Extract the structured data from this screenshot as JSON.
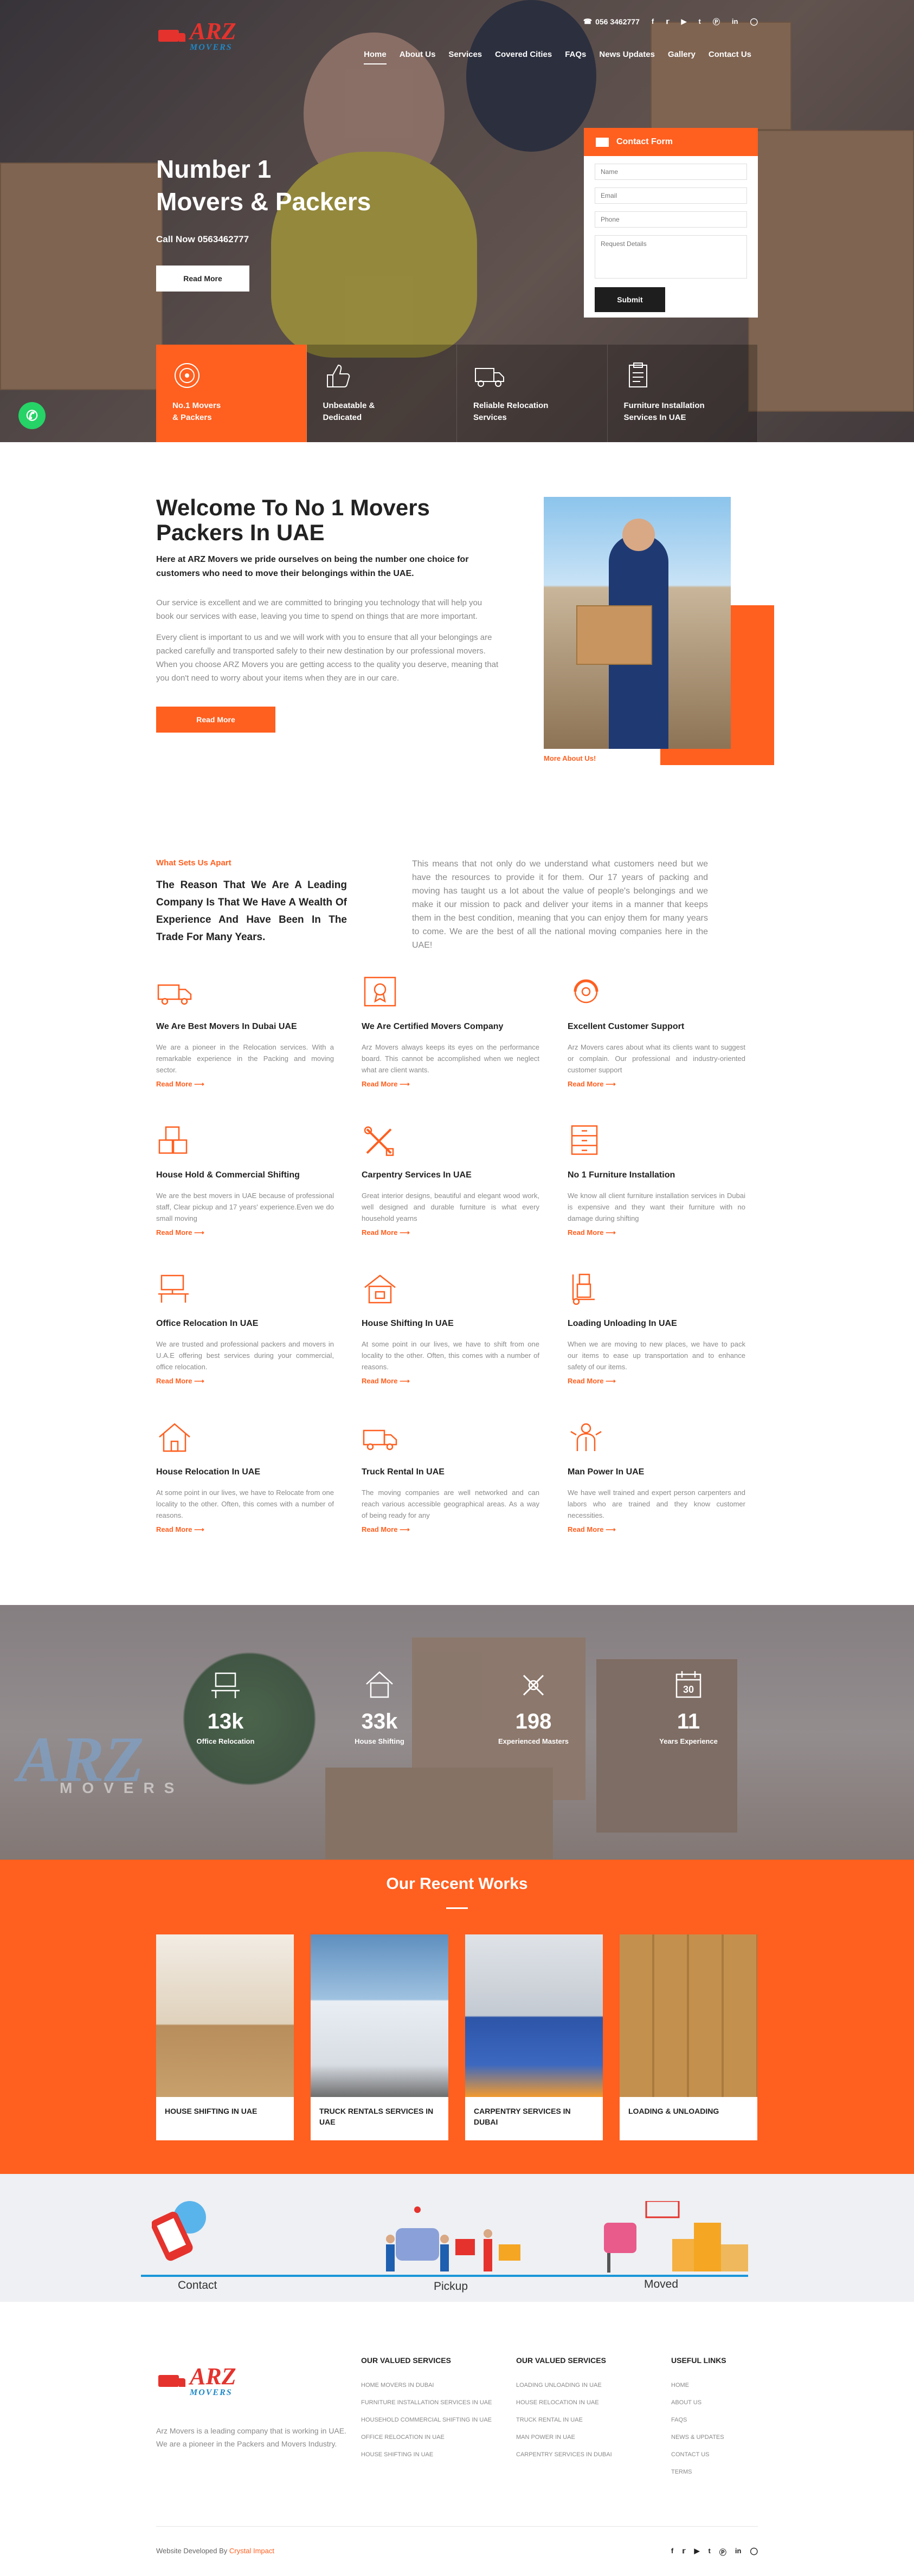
{
  "brand": {
    "logo_main": "ARZ",
    "logo_sub": "MOVERS",
    "accent": "#ff5f1f"
  },
  "topbar": {
    "phone": "056 3462777",
    "social": [
      "f",
      "t",
      "yt",
      "tu",
      "p",
      "in",
      "ig"
    ]
  },
  "nav": {
    "items": [
      "Home",
      "About Us",
      "Services",
      "Covered Cities",
      "FAQs",
      "News Updates",
      "Gallery",
      "Contact Us"
    ]
  },
  "hero": {
    "title_1": "Number 1",
    "title_2": "Movers & Packers",
    "call": "Call Now 0563462777",
    "button": "Read More"
  },
  "contact_form": {
    "title": "Contact Form",
    "name": "Name",
    "email": "Email",
    "phone": "Phone",
    "details": "Request Details",
    "submit": "Submit"
  },
  "features": [
    {
      "line1": "No.1 Movers",
      "line2": "& Packers",
      "icon": "target-icon"
    },
    {
      "line1": "Unbeatable &",
      "line2": "Dedicated",
      "icon": "thumbs-up-icon"
    },
    {
      "line1": "Reliable Relocation",
      "line2": "Services",
      "icon": "truck-icon"
    },
    {
      "line1": "Furniture Installation",
      "line2": "Services In UAE",
      "icon": "clipboard-icon"
    }
  ],
  "welcome": {
    "title": "Welcome To No 1 Movers Packers In UAE",
    "lead": "Here at ARZ Movers we pride ourselves on being the number one choice for customers who need to move their belongings within the UAE.",
    "p1": "Our service is excellent and we are committed to bringing you technology that will help you book our services with ease, leaving you time to spend on things that are more important.",
    "p2": "Every client is important to us and we will work with you to ensure that all your belongings are packed carefully and transported safely to their new destination by our professional movers. When you choose ARZ Movers you are getting access to the quality you deserve, meaning that you don't need to worry about your items when they are in our care.",
    "button": "Read More",
    "more_link": "More About Us!"
  },
  "sets_apart": {
    "tag": "What Sets Us Apart",
    "heading": "The Reason That We Are A Leading Company Is That We Have A Wealth Of Experience And Have Been In The Trade For Many Years.",
    "text": "This means that not only do we understand what customers need but we have the resources to provide it for them. Our 17 years of packing and moving has taught us a lot about the value of people's belongings and we make it our mission to pack and deliver your items in a manner that keeps them in the best condition, meaning that you can enjoy them for many years to come. We are the best of all the national moving companies here in the UAE!"
  },
  "services": [
    {
      "title": "We Are Best Movers In Dubai UAE",
      "text": "We are a pioneer in the Relocation services. With a remarkable experience in the Packing and moving sector.",
      "link": "Read More ⟶",
      "icon": "truck-icon"
    },
    {
      "title": "We Are Certified Movers Company",
      "text": "Arz Movers always keeps its eyes on the performance board. This cannot be accomplished when we neglect what are client wants.",
      "link": "Read More ⟶",
      "icon": "certificate-icon"
    },
    {
      "title": "Excellent Customer Support",
      "text": "Arz Movers cares about what its clients want to suggest or complain. Our professional and industry-oriented customer support",
      "link": "Read More ⟶",
      "icon": "support-icon"
    },
    {
      "title": "House Hold & Commercial Shifting",
      "text": "We are the best movers in UAE because of professional staff, Clear pickup and 17 years' experience.Even we do small moving",
      "link": "Read More ⟶",
      "icon": "boxes-icon"
    },
    {
      "title": "Carpentry Services In UAE",
      "text": "Great interior designs, beautiful and elegant wood work, well designed and durable furniture is what every household yearns",
      "link": "Read More ⟶",
      "icon": "tools-icon"
    },
    {
      "title": "No 1 Furniture Installation",
      "text": "We know all client furniture installation services in Dubai is expensive and they want their furniture with no damage during shifting",
      "link": "Read More ⟶",
      "icon": "cabinet-icon"
    },
    {
      "title": "Office Relocation In UAE",
      "text": "We are trusted and professional packers and movers in U.A.E offering best services during your commercial, office relocation.",
      "link": "Read More ⟶",
      "icon": "desk-icon"
    },
    {
      "title": "House Shifting In UAE",
      "text": "At some point in our lives, we have to shift from one locality to the other. Often, this comes with a number of reasons.",
      "link": "Read More ⟶",
      "icon": "house-box-icon"
    },
    {
      "title": "Loading Unloading In UAE",
      "text": "When we are moving to new places, we have to pack our items to ease up transportation and to enhance safety of our items.",
      "link": "Read More ⟶",
      "icon": "hand-truck-icon"
    },
    {
      "title": "House Relocation In UAE",
      "text": "At some point in our lives, we have to Relocate from one locality to the other. Often, this comes with a number of reasons.",
      "link": "Read More ⟶",
      "icon": "house-icon"
    },
    {
      "title": "Truck Rental In UAE",
      "text": "The moving companies are well networked and can reach various accessible geographical areas. As a way of being ready for any",
      "link": "Read More ⟶",
      "icon": "truck-icon"
    },
    {
      "title": "Man Power In UAE",
      "text": "We have well trained and expert person carpenters and labors who are trained and they know customer necessities.",
      "link": "Read More ⟶",
      "icon": "manpower-icon"
    }
  ],
  "counters": {
    "watermark": "ARZ",
    "watermark_sub": "MOVERS",
    "items": [
      {
        "value": "13k",
        "label": "Office Relocation",
        "icon": "office-icon"
      },
      {
        "value": "33k",
        "label": "House Shifting",
        "icon": "house-icon"
      },
      {
        "value": "198",
        "label": "Experienced Masters",
        "icon": "masters-icon"
      },
      {
        "value": "11",
        "label": "Years Experience",
        "icon": "calendar-icon"
      }
    ],
    "calendar_number": "30"
  },
  "works": {
    "title": "Our Recent Works",
    "items": [
      {
        "title": "HOUSE SHIFTING IN UAE",
        "bg": "#d8c4a8"
      },
      {
        "title": "TRUCK RENTALS SERVICES IN UAE",
        "bg": "#7aa4cc"
      },
      {
        "title": "CARPENTRY SERVICES IN DUBAI",
        "bg": "#c8ccd2"
      },
      {
        "title": "LOADING & UNLOADING",
        "bg": "#c79a5c"
      }
    ]
  },
  "process": {
    "steps": [
      "Contact",
      "Pickup",
      "Moved"
    ]
  },
  "footer": {
    "about": "Arz Movers is a leading company that is working in UAE. We are a pioneer in the Packers and Movers Industry.",
    "col1": {
      "title": "OUR VALUED SERVICES",
      "links": [
        "Home Movers In Dubai",
        "Furniture Installation Services In UAE",
        "Household Commercial Shifting In UAE",
        "Office Relocation In UAE",
        "House Shifting In UAE"
      ]
    },
    "col2": {
      "title": "OUR VALUED SERVICES",
      "links": [
        "Loading Unloading In UAE",
        "House Relocation In UAE",
        "Truck Rental In UAE",
        "Man Power In UAE",
        "Carpentry Services In Dubai"
      ]
    },
    "col3": {
      "title": "USEFUL LINKS",
      "links": [
        "Home",
        "About Us",
        "FAQs",
        "News & Updates",
        "Contact Us",
        "Terms"
      ]
    },
    "credit_prefix": "Website Developed By",
    "credit_name": "Crystal Impact",
    "social": [
      "f",
      "t",
      "yt",
      "tu",
      "p",
      "in",
      "ig"
    ]
  }
}
